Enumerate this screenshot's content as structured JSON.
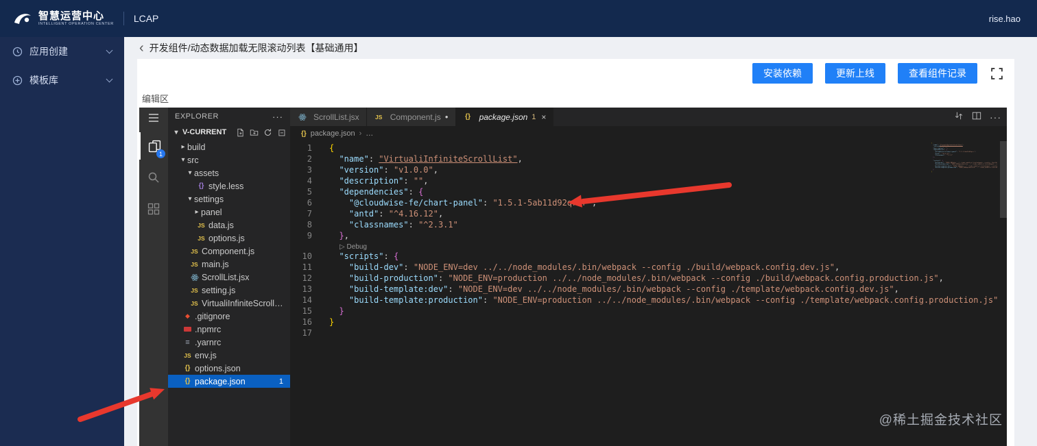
{
  "header": {
    "brand": "智慧运营中心",
    "brand_sub": "INTELLIGENT OPERATION CENTER",
    "product": "LCAP",
    "username": "rise.hao"
  },
  "nav": {
    "items": [
      {
        "label": "应用创建"
      },
      {
        "label": "模板库"
      }
    ]
  },
  "page": {
    "breadcrumb": "开发组件/动态数据加载无限滚动列表【基础通用】",
    "actions": [
      "安装依赖",
      "更新上线",
      "查看组件记录"
    ],
    "editor_label": "编辑区"
  },
  "vscode": {
    "activity": {
      "badge": "1"
    },
    "explorer": {
      "title": "EXPLORER",
      "more": "···",
      "root": "V-CURRENT",
      "tree": [
        {
          "label": "build",
          "level": 1,
          "type": "folder",
          "state": "collapsed"
        },
        {
          "label": "src",
          "level": 1,
          "type": "folder",
          "state": "expanded"
        },
        {
          "label": "assets",
          "level": 2,
          "type": "folder",
          "state": "expanded"
        },
        {
          "label": "style.less",
          "level": 3,
          "icon": "less"
        },
        {
          "label": "settings",
          "level": 2,
          "type": "folder",
          "state": "expanded"
        },
        {
          "label": "panel",
          "level": 3,
          "type": "folder",
          "state": "collapsed"
        },
        {
          "label": "data.js",
          "level": 3,
          "icon": "js"
        },
        {
          "label": "options.js",
          "level": 3,
          "icon": "js"
        },
        {
          "label": "Component.js",
          "level": 2,
          "icon": "js"
        },
        {
          "label": "main.js",
          "level": 2,
          "icon": "js"
        },
        {
          "label": "ScrollList.jsx",
          "level": 2,
          "icon": "react"
        },
        {
          "label": "setting.js",
          "level": 2,
          "icon": "js"
        },
        {
          "label": "VirtualiInfiniteScrollList.js",
          "level": 2,
          "icon": "js"
        },
        {
          "label": ".gitignore",
          "level": 1,
          "icon": "git"
        },
        {
          "label": ".npmrc",
          "level": 1,
          "icon": "npm"
        },
        {
          "label": ".yarnrc",
          "level": 1,
          "icon": "yarn"
        },
        {
          "label": "env.js",
          "level": 1,
          "icon": "js"
        },
        {
          "label": "options.json",
          "level": 1,
          "icon": "json"
        },
        {
          "label": "package.json",
          "level": 1,
          "icon": "json",
          "selected": true,
          "badge": "1"
        }
      ]
    },
    "tabs": [
      {
        "label": "ScrollList.jsx",
        "icon": "react"
      },
      {
        "label": "Component.js",
        "icon": "js",
        "modified": true
      },
      {
        "label": "package.json",
        "icon": "json",
        "badge": "1",
        "active": true,
        "italic": true,
        "closable": true
      }
    ],
    "breadcrumb": {
      "file": "package.json",
      "more": "…"
    },
    "code": {
      "lines": [
        {
          "n": 1,
          "seg": [
            [
              "{",
              "b1"
            ]
          ]
        },
        {
          "n": 2,
          "seg": [
            [
              "  ",
              "p"
            ],
            [
              "\"name\"",
              "k"
            ],
            [
              ": ",
              "p"
            ],
            [
              "\"VirtualiInfiniteScrollList\"",
              "su"
            ],
            [
              ",",
              "p"
            ]
          ]
        },
        {
          "n": 3,
          "seg": [
            [
              "  ",
              "p"
            ],
            [
              "\"version\"",
              "k"
            ],
            [
              ": ",
              "p"
            ],
            [
              "\"v1.0.0\"",
              "s"
            ],
            [
              ",",
              "p"
            ]
          ]
        },
        {
          "n": 4,
          "seg": [
            [
              "  ",
              "p"
            ],
            [
              "\"description\"",
              "k"
            ],
            [
              ": ",
              "p"
            ],
            [
              "\"\"",
              "s"
            ],
            [
              ",",
              "p"
            ]
          ]
        },
        {
          "n": 5,
          "seg": [
            [
              "  ",
              "p"
            ],
            [
              "\"dependencies\"",
              "k"
            ],
            [
              ": ",
              "p"
            ],
            [
              "{",
              "b2"
            ]
          ]
        },
        {
          "n": 6,
          "seg": [
            [
              "    ",
              "p"
            ],
            [
              "\"@cloudwise-fe/chart-panel\"",
              "k"
            ],
            [
              ": ",
              "p"
            ],
            [
              "\"1.5.1-5ab11d92qrrr\"",
              "s"
            ],
            [
              ",",
              "p"
            ]
          ]
        },
        {
          "n": 7,
          "seg": [
            [
              "    ",
              "p"
            ],
            [
              "\"antd\"",
              "k"
            ],
            [
              ": ",
              "p"
            ],
            [
              "\"^4.16.12\"",
              "s"
            ],
            [
              ",",
              "p"
            ]
          ]
        },
        {
          "n": 8,
          "seg": [
            [
              "    ",
              "p"
            ],
            [
              "\"classnames\"",
              "k"
            ],
            [
              ": ",
              "p"
            ],
            [
              "\"^2.3.1\"",
              "s"
            ]
          ]
        },
        {
          "n": 9,
          "seg": [
            [
              "  ",
              "p"
            ],
            [
              "}",
              "b2"
            ],
            [
              ",",
              "p"
            ]
          ]
        },
        {
          "lens": "Debug"
        },
        {
          "n": 10,
          "seg": [
            [
              "  ",
              "p"
            ],
            [
              "\"scripts\"",
              "k"
            ],
            [
              ": ",
              "p"
            ],
            [
              "{",
              "b2"
            ]
          ]
        },
        {
          "n": 11,
          "seg": [
            [
              "    ",
              "p"
            ],
            [
              "\"build-dev\"",
              "k"
            ],
            [
              ": ",
              "p"
            ],
            [
              "\"NODE_ENV=dev ../../node_modules/.bin/webpack --config ./build/webpack.config.dev.js\"",
              "s"
            ],
            [
              ",",
              "p"
            ]
          ]
        },
        {
          "n": 12,
          "seg": [
            [
              "    ",
              "p"
            ],
            [
              "\"build-production\"",
              "k"
            ],
            [
              ": ",
              "p"
            ],
            [
              "\"NODE_ENV=production ../../node_modules/.bin/webpack --config ./build/webpack.config.production.js\"",
              "s"
            ],
            [
              ",",
              "p"
            ]
          ]
        },
        {
          "n": 13,
          "seg": [
            [
              "    ",
              "p"
            ],
            [
              "\"build-template:dev\"",
              "k"
            ],
            [
              ": ",
              "p"
            ],
            [
              "\"NODE_ENV=dev ../../node_modules/.bin/webpack --config ./template/webpack.config.dev.js\"",
              "s"
            ],
            [
              ",",
              "p"
            ]
          ]
        },
        {
          "n": 14,
          "seg": [
            [
              "    ",
              "p"
            ],
            [
              "\"build-template:production\"",
              "k"
            ],
            [
              ": ",
              "p"
            ],
            [
              "\"NODE_ENV=production ../../node_modules/.bin/webpack --config ./template/webpack.config.production.js\"",
              "s"
            ]
          ]
        },
        {
          "n": 15,
          "seg": [
            [
              "  ",
              "p"
            ],
            [
              "}",
              "b2"
            ]
          ]
        },
        {
          "n": 16,
          "seg": [
            [
              "}",
              "b1"
            ]
          ]
        },
        {
          "n": 17,
          "seg": []
        }
      ]
    }
  },
  "watermark": "@稀土掘金技术社区"
}
